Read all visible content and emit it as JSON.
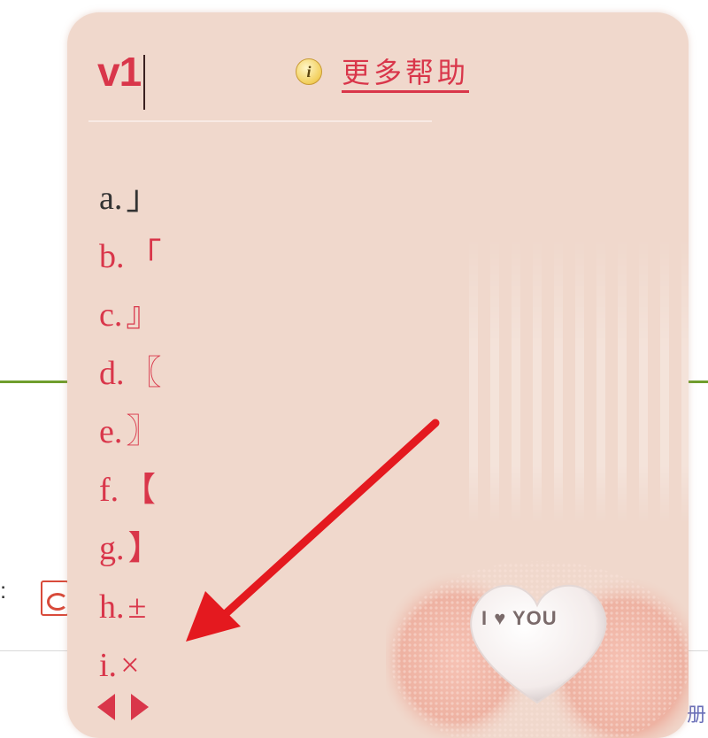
{
  "ime": {
    "input_code": "v1",
    "help_label": "更多帮助",
    "help_icon": "info-icon",
    "candidates": [
      {
        "label": "a.",
        "symbol": "」"
      },
      {
        "label": "b.",
        "symbol": "「"
      },
      {
        "label": "c.",
        "symbol": "』"
      },
      {
        "label": "d.",
        "symbol": "〖"
      },
      {
        "label": "e.",
        "symbol": "〗"
      },
      {
        "label": "f.",
        "symbol": "【"
      },
      {
        "label": "g.",
        "symbol": "】"
      },
      {
        "label": "h.",
        "symbol": "±"
      },
      {
        "label": "i.",
        "symbol": "×"
      }
    ],
    "image_text": "I ♥ YOU"
  },
  "background": {
    "colon": ":",
    "corner_char": "册"
  },
  "colors": {
    "panel_bg": "#f0d8cc",
    "accent_red": "#d9364a",
    "first_candidate": "#333333",
    "green_line": "#6f9e2d"
  }
}
